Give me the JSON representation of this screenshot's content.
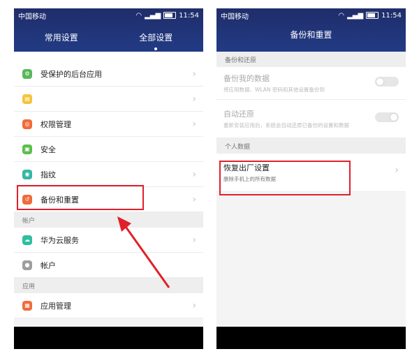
{
  "left": {
    "status": {
      "carrier": "中国移动",
      "time": "11:54"
    },
    "tabs": [
      {
        "label": "常用设置"
      },
      {
        "label": "全部设置"
      }
    ],
    "rows": [
      {
        "label": "受保护的后台应用",
        "color": "#58b85a"
      },
      {
        "label": "",
        "color": "#f4c43a"
      },
      {
        "label": "权限管理",
        "color": "#f06b3b"
      },
      {
        "label": "安全",
        "color": "#5bbf4b"
      },
      {
        "label": "指纹",
        "color": "#37b6a5"
      },
      {
        "label": "备份和重置",
        "color": "#f06b3b"
      }
    ],
    "section_account": "帐户",
    "rows2": [
      {
        "label": "华为云服务",
        "color": "#2ebfa0"
      },
      {
        "label": "帐户",
        "color": "#9e9e9e"
      }
    ],
    "section_apps": "应用",
    "rows3": [
      {
        "label": "应用管理",
        "color": "#f06b3b"
      }
    ]
  },
  "right": {
    "status": {
      "carrier": "中国移动",
      "time": "11:54"
    },
    "title": "备份和重置",
    "section_backup": "备份和还原",
    "backup_my_data": {
      "title": "备份我的数据",
      "subtitle": "将应用数据、WLAN 密码和其他设置备份到"
    },
    "auto_restore": {
      "title": "自动还原",
      "subtitle": "重新安装应用后，系统会自动还原已备份的设置和数据"
    },
    "section_personal": "个人数据",
    "factory_reset": {
      "title": "恢复出厂设置",
      "subtitle": "删除手机上的所有数据"
    }
  },
  "colors": {
    "header": "#223b85",
    "highlight": "#e0202a"
  }
}
